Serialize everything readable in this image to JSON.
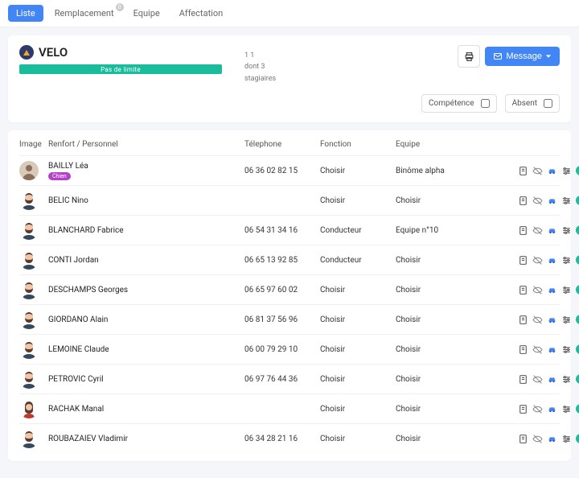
{
  "tabs": [
    {
      "label": "Liste",
      "active": true
    },
    {
      "label": "Remplacement",
      "active": false,
      "badge": "0"
    },
    {
      "label": "Equipe",
      "active": false
    },
    {
      "label": "Affectation",
      "active": false
    }
  ],
  "header": {
    "title": "VELO",
    "progress_label": "Pas de limite",
    "meta_count": "1 1",
    "meta_extra": "dont 3",
    "meta_stagiaires": "stagiaires",
    "message_label": "Message"
  },
  "filters": {
    "competence_label": "Compétence",
    "absent_label": "Absent"
  },
  "columns": {
    "image": "Image",
    "renfort": "Renfort / Personnel",
    "telephone": "Télephone",
    "fonction": "Fonction",
    "equipe": "Equipe"
  },
  "rows": [
    {
      "name": "BAILLY Léa",
      "tag": "Chien",
      "phone": "06 36 02 82 15",
      "fonction": "Choisir",
      "equipe": "Binôme alpha",
      "avatar": "photo"
    },
    {
      "name": "BELIC Nino",
      "phone": "",
      "fonction": "Choisir",
      "equipe": "Choisir",
      "avatar": "m1"
    },
    {
      "name": "BLANCHARD Fabrice",
      "phone": "06 54 31 34 16",
      "fonction": "Conducteur",
      "equipe": "Equipe n°10",
      "avatar": "m2"
    },
    {
      "name": "CONTI Jordan",
      "phone": "06 65 13 92 85",
      "fonction": "Conducteur",
      "equipe": "Choisir",
      "avatar": "m1"
    },
    {
      "name": "DESCHAMPS Georges",
      "phone": "06 65 97 60 02",
      "fonction": "Choisir",
      "equipe": "Choisir",
      "avatar": "m2"
    },
    {
      "name": "GIORDANO Alain",
      "phone": "06 81 37 56 96",
      "fonction": "Choisir",
      "equipe": "Choisir",
      "avatar": "m1"
    },
    {
      "name": "LEMOINE Claude",
      "phone": "06 00 79 29 10",
      "fonction": "Choisir",
      "equipe": "Choisir",
      "avatar": "m2"
    },
    {
      "name": "PETROVIC Cyril",
      "phone": "06 97 76 44 36",
      "fonction": "Choisir",
      "equipe": "Choisir",
      "avatar": "m2"
    },
    {
      "name": "RACHAK Manal",
      "phone": "",
      "fonction": "Choisir",
      "equipe": "Choisir",
      "avatar": "f1"
    },
    {
      "name": "ROUBAZAIEV Vladimir",
      "phone": "06 34 28 21 16",
      "fonction": "Choisir",
      "equipe": "Choisir",
      "avatar": "m2"
    }
  ]
}
